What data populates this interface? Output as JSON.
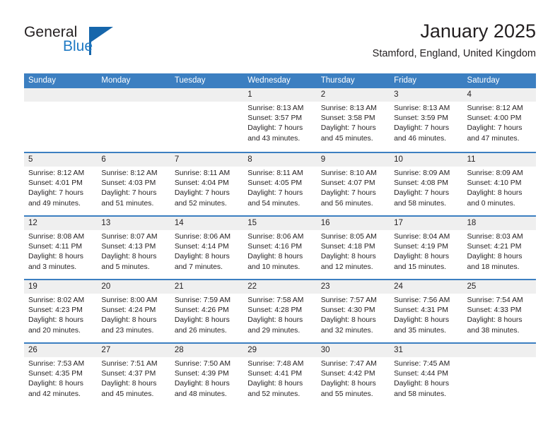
{
  "brand": {
    "name_part1": "General",
    "name_part2": "Blue",
    "accent_color": "#1666ab",
    "logo_icon": "triangle-flag-icon"
  },
  "header": {
    "title": "January 2025",
    "subtitle": "Stamford, England, United Kingdom"
  },
  "calendar": {
    "header_color": "#3c7fc1",
    "weekdays": [
      "Sunday",
      "Monday",
      "Tuesday",
      "Wednesday",
      "Thursday",
      "Friday",
      "Saturday"
    ],
    "weeks": [
      [
        {
          "day": "",
          "lines": [
            "",
            "",
            "",
            ""
          ]
        },
        {
          "day": "",
          "lines": [
            "",
            "",
            "",
            ""
          ]
        },
        {
          "day": "",
          "lines": [
            "",
            "",
            "",
            ""
          ]
        },
        {
          "day": "1",
          "lines": [
            "Sunrise: 8:13 AM",
            "Sunset: 3:57 PM",
            "Daylight: 7 hours",
            "and 43 minutes."
          ]
        },
        {
          "day": "2",
          "lines": [
            "Sunrise: 8:13 AM",
            "Sunset: 3:58 PM",
            "Daylight: 7 hours",
            "and 45 minutes."
          ]
        },
        {
          "day": "3",
          "lines": [
            "Sunrise: 8:13 AM",
            "Sunset: 3:59 PM",
            "Daylight: 7 hours",
            "and 46 minutes."
          ]
        },
        {
          "day": "4",
          "lines": [
            "Sunrise: 8:12 AM",
            "Sunset: 4:00 PM",
            "Daylight: 7 hours",
            "and 47 minutes."
          ]
        }
      ],
      [
        {
          "day": "5",
          "lines": [
            "Sunrise: 8:12 AM",
            "Sunset: 4:01 PM",
            "Daylight: 7 hours",
            "and 49 minutes."
          ]
        },
        {
          "day": "6",
          "lines": [
            "Sunrise: 8:12 AM",
            "Sunset: 4:03 PM",
            "Daylight: 7 hours",
            "and 51 minutes."
          ]
        },
        {
          "day": "7",
          "lines": [
            "Sunrise: 8:11 AM",
            "Sunset: 4:04 PM",
            "Daylight: 7 hours",
            "and 52 minutes."
          ]
        },
        {
          "day": "8",
          "lines": [
            "Sunrise: 8:11 AM",
            "Sunset: 4:05 PM",
            "Daylight: 7 hours",
            "and 54 minutes."
          ]
        },
        {
          "day": "9",
          "lines": [
            "Sunrise: 8:10 AM",
            "Sunset: 4:07 PM",
            "Daylight: 7 hours",
            "and 56 minutes."
          ]
        },
        {
          "day": "10",
          "lines": [
            "Sunrise: 8:09 AM",
            "Sunset: 4:08 PM",
            "Daylight: 7 hours",
            "and 58 minutes."
          ]
        },
        {
          "day": "11",
          "lines": [
            "Sunrise: 8:09 AM",
            "Sunset: 4:10 PM",
            "Daylight: 8 hours",
            "and 0 minutes."
          ]
        }
      ],
      [
        {
          "day": "12",
          "lines": [
            "Sunrise: 8:08 AM",
            "Sunset: 4:11 PM",
            "Daylight: 8 hours",
            "and 3 minutes."
          ]
        },
        {
          "day": "13",
          "lines": [
            "Sunrise: 8:07 AM",
            "Sunset: 4:13 PM",
            "Daylight: 8 hours",
            "and 5 minutes."
          ]
        },
        {
          "day": "14",
          "lines": [
            "Sunrise: 8:06 AM",
            "Sunset: 4:14 PM",
            "Daylight: 8 hours",
            "and 7 minutes."
          ]
        },
        {
          "day": "15",
          "lines": [
            "Sunrise: 8:06 AM",
            "Sunset: 4:16 PM",
            "Daylight: 8 hours",
            "and 10 minutes."
          ]
        },
        {
          "day": "16",
          "lines": [
            "Sunrise: 8:05 AM",
            "Sunset: 4:18 PM",
            "Daylight: 8 hours",
            "and 12 minutes."
          ]
        },
        {
          "day": "17",
          "lines": [
            "Sunrise: 8:04 AM",
            "Sunset: 4:19 PM",
            "Daylight: 8 hours",
            "and 15 minutes."
          ]
        },
        {
          "day": "18",
          "lines": [
            "Sunrise: 8:03 AM",
            "Sunset: 4:21 PM",
            "Daylight: 8 hours",
            "and 18 minutes."
          ]
        }
      ],
      [
        {
          "day": "19",
          "lines": [
            "Sunrise: 8:02 AM",
            "Sunset: 4:23 PM",
            "Daylight: 8 hours",
            "and 20 minutes."
          ]
        },
        {
          "day": "20",
          "lines": [
            "Sunrise: 8:00 AM",
            "Sunset: 4:24 PM",
            "Daylight: 8 hours",
            "and 23 minutes."
          ]
        },
        {
          "day": "21",
          "lines": [
            "Sunrise: 7:59 AM",
            "Sunset: 4:26 PM",
            "Daylight: 8 hours",
            "and 26 minutes."
          ]
        },
        {
          "day": "22",
          "lines": [
            "Sunrise: 7:58 AM",
            "Sunset: 4:28 PM",
            "Daylight: 8 hours",
            "and 29 minutes."
          ]
        },
        {
          "day": "23",
          "lines": [
            "Sunrise: 7:57 AM",
            "Sunset: 4:30 PM",
            "Daylight: 8 hours",
            "and 32 minutes."
          ]
        },
        {
          "day": "24",
          "lines": [
            "Sunrise: 7:56 AM",
            "Sunset: 4:31 PM",
            "Daylight: 8 hours",
            "and 35 minutes."
          ]
        },
        {
          "day": "25",
          "lines": [
            "Sunrise: 7:54 AM",
            "Sunset: 4:33 PM",
            "Daylight: 8 hours",
            "and 38 minutes."
          ]
        }
      ],
      [
        {
          "day": "26",
          "lines": [
            "Sunrise: 7:53 AM",
            "Sunset: 4:35 PM",
            "Daylight: 8 hours",
            "and 42 minutes."
          ]
        },
        {
          "day": "27",
          "lines": [
            "Sunrise: 7:51 AM",
            "Sunset: 4:37 PM",
            "Daylight: 8 hours",
            "and 45 minutes."
          ]
        },
        {
          "day": "28",
          "lines": [
            "Sunrise: 7:50 AM",
            "Sunset: 4:39 PM",
            "Daylight: 8 hours",
            "and 48 minutes."
          ]
        },
        {
          "day": "29",
          "lines": [
            "Sunrise: 7:48 AM",
            "Sunset: 4:41 PM",
            "Daylight: 8 hours",
            "and 52 minutes."
          ]
        },
        {
          "day": "30",
          "lines": [
            "Sunrise: 7:47 AM",
            "Sunset: 4:42 PM",
            "Daylight: 8 hours",
            "and 55 minutes."
          ]
        },
        {
          "day": "31",
          "lines": [
            "Sunrise: 7:45 AM",
            "Sunset: 4:44 PM",
            "Daylight: 8 hours",
            "and 58 minutes."
          ]
        },
        {
          "day": "",
          "lines": [
            "",
            "",
            "",
            ""
          ]
        }
      ]
    ]
  }
}
